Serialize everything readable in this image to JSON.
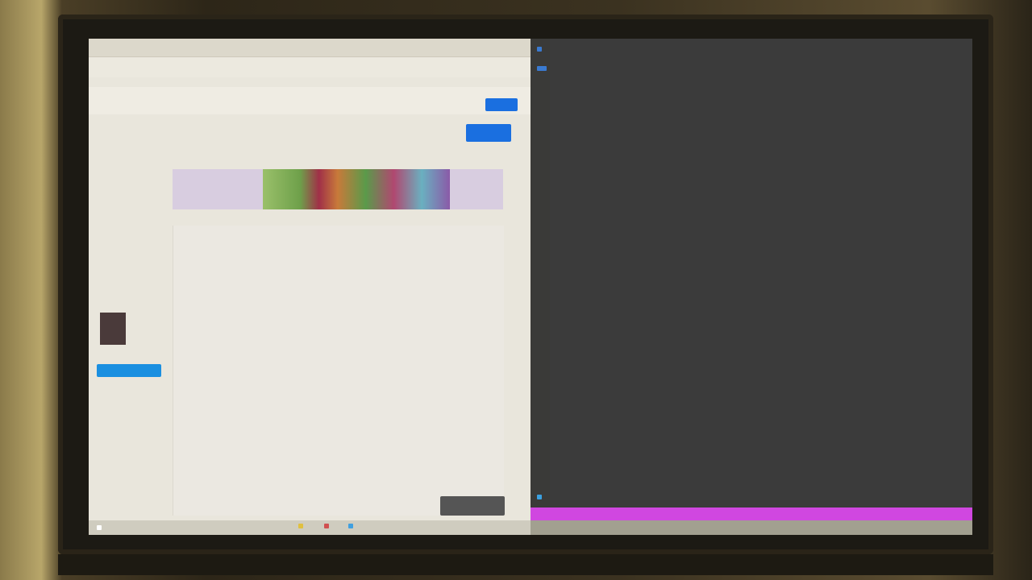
{
  "browser": {
    "tab_title": "",
    "address": "",
    "signin_label": "",
    "action_label": ""
  },
  "sidebar": {
    "items": [
      "",
      "",
      "",
      "",
      ""
    ],
    "cta_label": ""
  },
  "content": {
    "breadcrumb": "",
    "banner_line1": "",
    "banner_line2": "",
    "banner_line3": "",
    "banner_badge": ""
  },
  "terminal": {
    "title": "",
    "path": "",
    "line1": ""
  },
  "taskbar": {
    "left_label": "",
    "mid_label": "",
    "center_label": ""
  },
  "colors": {
    "primary_button": "#1a6fe0",
    "terminal_bg": "#3b3b3b",
    "terminal_status": "#d047e0",
    "cta": "#1a8fe0"
  },
  "icons": [
    "window-menu-icon",
    "terminal-icon",
    "settings-icon"
  ]
}
